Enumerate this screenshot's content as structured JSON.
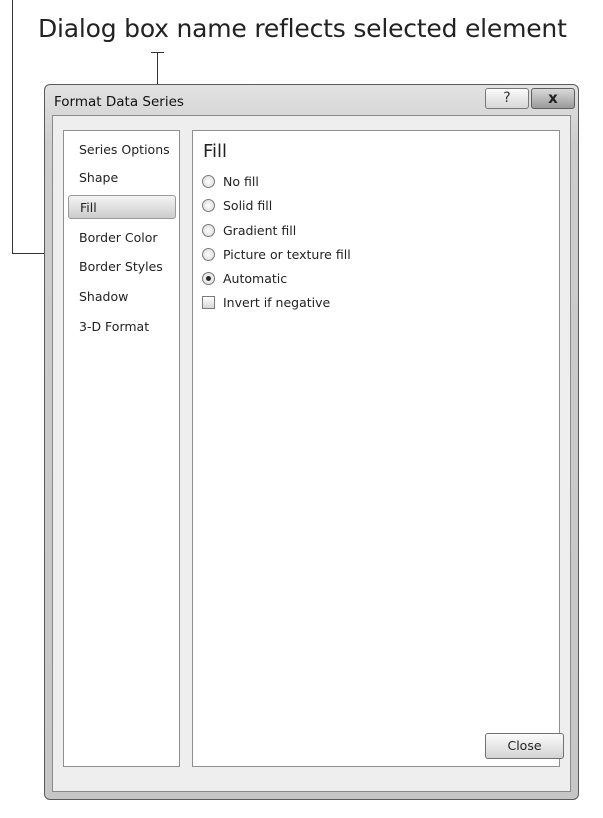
{
  "callout": {
    "text": "Dialog box name reflects selected element"
  },
  "dialog": {
    "title": "Format Data Series",
    "help_glyph": "?",
    "close_glyph": "x",
    "close_button_label": "Close"
  },
  "nav": {
    "items": [
      {
        "label": "Series Options",
        "selected": false
      },
      {
        "label": "Shape",
        "selected": false
      },
      {
        "label": "Fill",
        "selected": true
      },
      {
        "label": "Border Color",
        "selected": false
      },
      {
        "label": "Border Styles",
        "selected": false
      },
      {
        "label": "Shadow",
        "selected": false
      },
      {
        "label": "3-D Format",
        "selected": false
      }
    ]
  },
  "fill": {
    "title": "Fill",
    "options": [
      {
        "label": "No fill",
        "type": "radio",
        "checked": false
      },
      {
        "label": "Solid fill",
        "type": "radio",
        "checked": false
      },
      {
        "label": "Gradient fill",
        "type": "radio",
        "checked": false
      },
      {
        "label": "Picture or texture fill",
        "type": "radio",
        "checked": false
      },
      {
        "label": "Automatic",
        "type": "radio",
        "checked": true
      },
      {
        "label": "Invert if negative",
        "type": "checkbox",
        "checked": false
      }
    ]
  }
}
